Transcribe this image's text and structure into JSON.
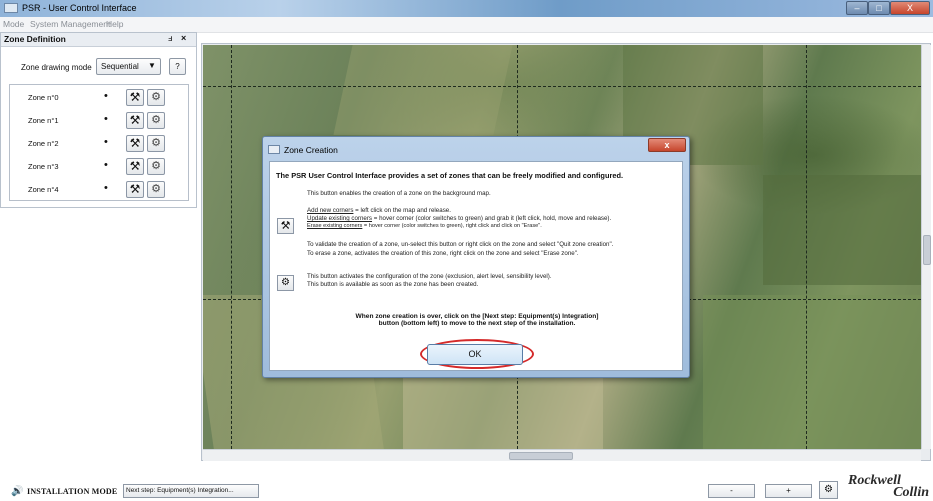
{
  "window": {
    "title": "PSR - User Control Interface",
    "minimize_glyph": "–",
    "maximize_glyph": "□",
    "close_glyph": "X"
  },
  "menu": [
    "Mode",
    "System Management",
    "Help"
  ],
  "zone_panel": {
    "title": "Zone Definition",
    "pin_glyph": "ⅎ",
    "close_glyph": "×",
    "drawing_mode_label": "Zone drawing mode",
    "drawing_mode_value": "Sequential",
    "help_glyph": "?",
    "zones": [
      {
        "label": "Zone n°0",
        "dot": "•"
      },
      {
        "label": "Zone n°1",
        "dot": "•"
      },
      {
        "label": "Zone n°2",
        "dot": "•"
      },
      {
        "label": "Zone n°3",
        "dot": "•"
      },
      {
        "label": "Zone n°4",
        "dot": "•"
      }
    ],
    "create_icon": "tools-icon",
    "config_icon": "gear-icon"
  },
  "dialog": {
    "title": "Zone Creation",
    "close_glyph": "x",
    "heading": "The PSR User Control Interface provides a set of zones that can be freely modified and configured.",
    "intro": "This button enables the creation of a zone on the background map.",
    "add_corners_link": "Add new corners",
    "add_corners_text": " = left click on the map and release.",
    "update_corners_link": "Update existing corners",
    "update_corners_text": " = hover corner (color switches to green) and grab it (left click, hold, move and release).",
    "erase_corners_link": "Erase existing corners",
    "erase_corners_text": " = hover corner (color switches to green), right click and click on \"Erase\".",
    "validate_line1": "To validate the creation of a zone, un-select this button or right click on the zone and select \"Quit zone creation\".",
    "validate_line2": "To erase a zone, activates the creation of this zone, right click on the zone and select \"Erase zone\".",
    "config_line1": "This button activates the configuration of the zone (exclusion, alert level, sensibility level).",
    "config_line2": "This button is available as soon as the zone has been created.",
    "footer_line1": "When zone creation is over, click on the [Next step: Equipment(s) Integration]",
    "footer_line2": "button (bottom left) to move to the next step of the installation.",
    "ok_label": "OK"
  },
  "bottom": {
    "mode_status": "INSTALLATION MODE",
    "next_step_label": "Next step: Equipment(s) Integration...",
    "zoom_out": "-",
    "zoom_in": "+",
    "settings_icon": "gear-icon",
    "logo_line1": "Rockwell",
    "logo_line2": "Collin"
  },
  "colors": {
    "ok_highlight": "#d42a2a",
    "titlebar": "#8fb3d9",
    "close_button": "#c7452c"
  }
}
